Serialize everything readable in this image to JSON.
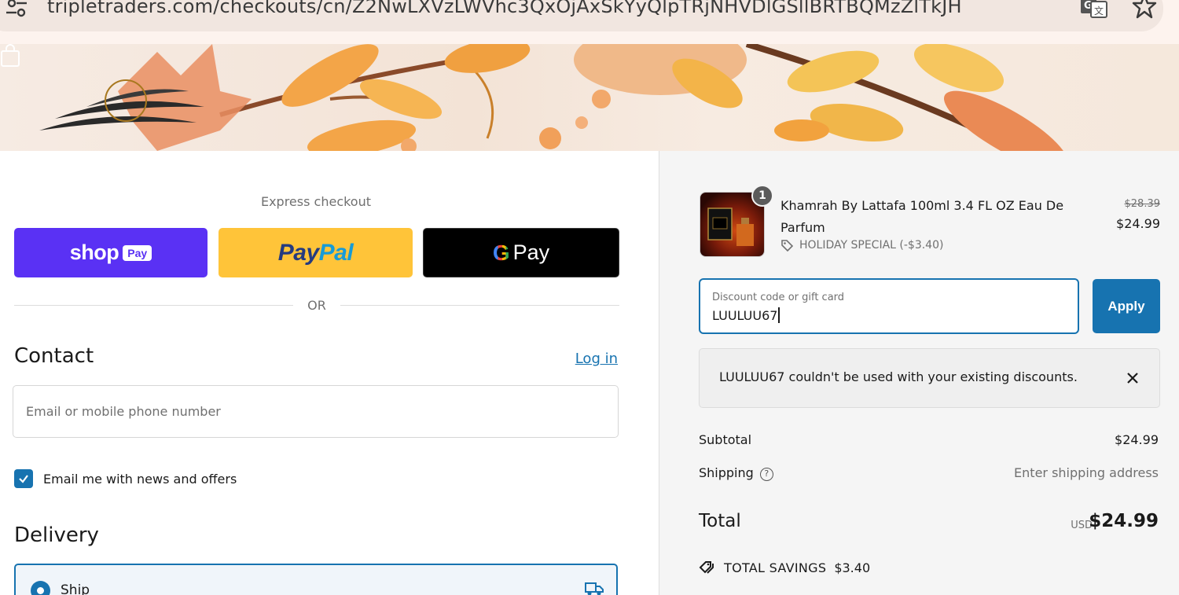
{
  "browser": {
    "url": "tripletraders.com/checkouts/cn/Z2NwLXVzLWVhc3QxOjAxSkYyQlpTRjNHVDlGSllBRTBQMzZlTkJH"
  },
  "express": {
    "label": "Express checkout",
    "shop_word": "shop",
    "shop_pay": "Pay",
    "paypal_1": "Pay",
    "paypal_2": "Pal",
    "gpay_g": "G",
    "gpay_word": "Pay",
    "or": "OR"
  },
  "contact": {
    "heading": "Contact",
    "login": "Log in",
    "email_placeholder": "Email or mobile phone number",
    "newsletter_label": "Email me with news and offers",
    "newsletter_checked": true
  },
  "delivery": {
    "heading": "Delivery",
    "option_label": "Ship"
  },
  "cart": {
    "item": {
      "quantity": "1",
      "name": "Khamrah By Lattafa 100ml 3.4 FL OZ Eau De Parfum",
      "discount_label": "HOLIDAY SPECIAL (-$3.40)",
      "old_price": "$28.39",
      "price": "$24.99"
    },
    "discount_field": {
      "label": "Discount code or gift card",
      "value": "LUULUU67"
    },
    "apply_label": "Apply",
    "error_message": "LUULUU67 couldn't be used with your existing discounts.",
    "subtotal_label": "Subtotal",
    "subtotal_value": "$24.99",
    "shipping_label": "Shipping",
    "shipping_value": "Enter shipping address",
    "total_label": "Total",
    "currency": "USD",
    "total_value": "$24.99",
    "savings_label": "TOTAL SAVINGS",
    "savings_value": "$3.40"
  },
  "colors": {
    "accent": "#1773b0",
    "shop_pay": "#5a31f4",
    "paypal": "#ffc439",
    "gpay": "#000000"
  }
}
